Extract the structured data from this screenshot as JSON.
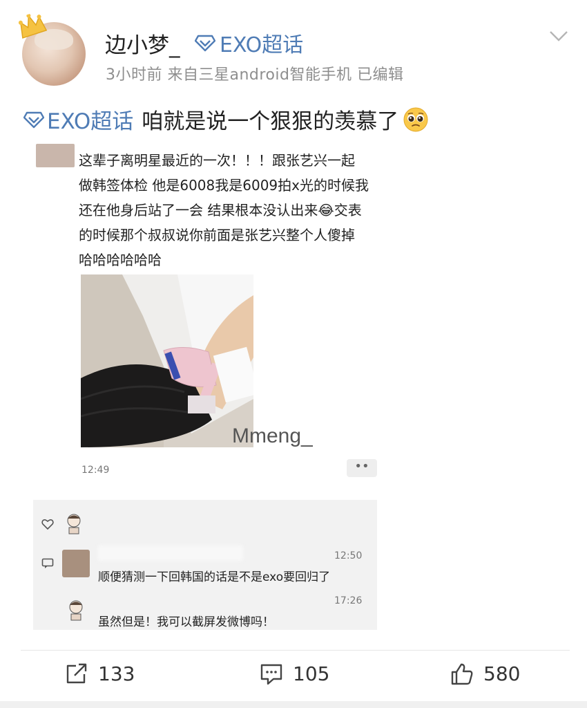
{
  "header": {
    "username": "边小梦_",
    "super_topic": "EXO超话",
    "meta": "3小时前  来自三星android智能手机  已编辑"
  },
  "post": {
    "topic": "EXO超话",
    "text": "咱就是说一个狠狠的羡慕了"
  },
  "screenshot": {
    "quote_lines": [
      "这辈子离明星最近的一次！！！跟张艺兴一起",
      "做韩签体检 他是6008我是6009拍x光的时候我",
      "还在他身后站了一会 结果根本没认出来😂交表",
      "的时候那个叔叔说你前面是张艺兴整个人傻掉",
      "哈哈哈哈哈哈"
    ],
    "watermark": "Mmeng_",
    "time": "12:49",
    "more_label": "••",
    "comments": [
      {
        "time": "12:50",
        "text": "顺便猜测一下回韩国的话是不是exo要回归了"
      },
      {
        "time": "17:26",
        "text": "虽然但是！我可以截屏发微博吗！"
      }
    ]
  },
  "actions": {
    "repost_count": "133",
    "comment_count": "105",
    "like_count": "580"
  },
  "colors": {
    "link_blue": "#4f7cb5",
    "meta_gray": "#8e8e8e",
    "crown_gold": "#f5c242"
  }
}
